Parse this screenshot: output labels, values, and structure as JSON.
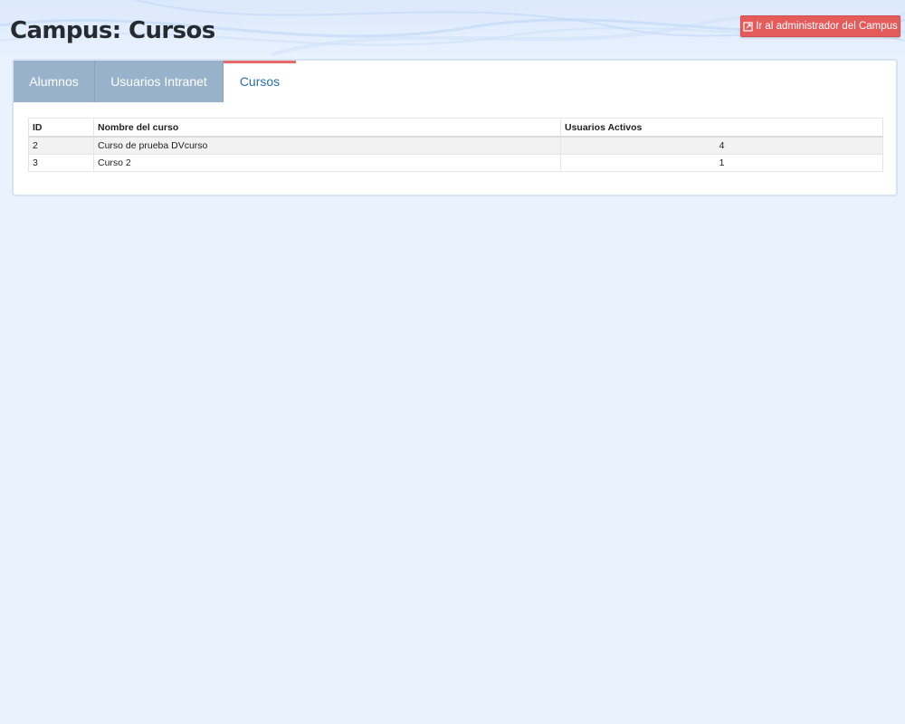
{
  "page": {
    "title": "Campus: Cursos"
  },
  "admin_button": {
    "label": "Ir al administrador del Campus",
    "icon": "external-link-icon"
  },
  "tabs": [
    {
      "label": "Alumnos",
      "active": false
    },
    {
      "label": "Usuarios Intranet",
      "active": false
    },
    {
      "label": "Cursos",
      "active": true
    }
  ],
  "table": {
    "columns": [
      "ID",
      "Nombre del curso",
      "Usuarios Activos"
    ],
    "rows": [
      {
        "id": "2",
        "name": "Curso de prueba DVcurso",
        "active_users": "4"
      },
      {
        "id": "3",
        "name": "Curso 2",
        "active_users": "1"
      }
    ]
  },
  "colors": {
    "background": "#eaf2fe",
    "accent_red": "#e35b5b",
    "tab_inactive": "#99b2cc",
    "tab_active_text": "#2a6fa8"
  }
}
